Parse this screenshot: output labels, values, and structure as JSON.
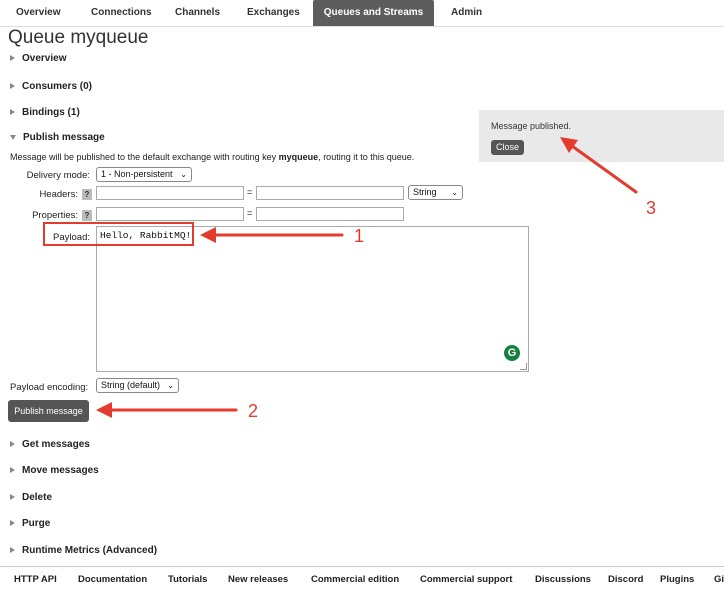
{
  "nav": {
    "tabs": [
      "Overview",
      "Connections",
      "Channels",
      "Exchanges",
      "Queues and Streams",
      "Admin"
    ],
    "active": "Queues and Streams"
  },
  "page": {
    "title_prefix": "Queue",
    "queue_name": "myqueue"
  },
  "sections": {
    "overview": "Overview",
    "consumers": "Consumers (0)",
    "bindings": "Bindings (1)",
    "publish": "Publish message",
    "get": "Get messages",
    "move": "Move messages",
    "delete": "Delete",
    "purge": "Purge",
    "runtime": "Runtime Metrics (Advanced)"
  },
  "publish_form": {
    "info_before": "Message will be published to the default exchange with routing key ",
    "info_key": "myqueue",
    "info_after": ", routing it to this queue.",
    "delivery_label": "Delivery mode:",
    "delivery_value": "1 - Non-persistent",
    "headers_label": "Headers:",
    "properties_label": "Properties:",
    "help_mark": "?",
    "equals": "=",
    "header_type": "String",
    "payload_label": "Payload:",
    "payload_value": "Hello, RabbitMQ!",
    "encoding_label": "Payload encoding:",
    "encoding_value": "String (default)",
    "publish_button": "Publish message",
    "grammarly_badge": "G"
  },
  "notification": {
    "text": "Message published.",
    "close": "Close"
  },
  "annotations": [
    "1",
    "2",
    "3"
  ],
  "footer": {
    "links": [
      "HTTP API",
      "Documentation",
      "Tutorials",
      "New releases",
      "Commercial edition",
      "Commercial support",
      "Discussions",
      "Discord",
      "Plugins",
      "GitHub"
    ]
  },
  "colors": {
    "annotation_red": "#e33b2e",
    "active_tab": "#5d5d5d",
    "button_dark": "#555555"
  }
}
